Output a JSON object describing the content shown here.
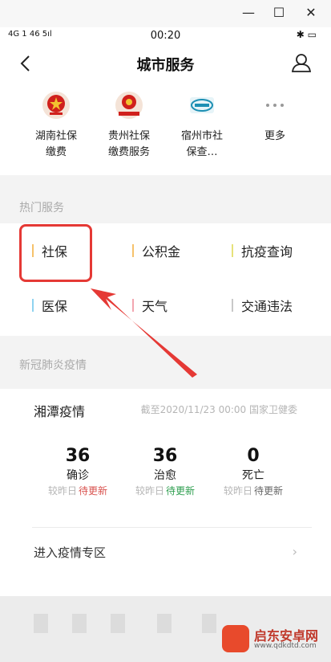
{
  "window": {
    "minimize_glyph": "—",
    "maximize_glyph": "☐",
    "close_glyph": "✕"
  },
  "status_bar": {
    "signal_text": "4G 1 46  5ıl",
    "time": "00:20",
    "right_icons": "✱ ▭"
  },
  "header": {
    "title": "城市服务",
    "back_icon": "chevron-left-icon",
    "user_icon": "user-icon"
  },
  "apps": [
    {
      "label_line1": "湖南社保",
      "label_line2": "缴费",
      "icon": "national-emblem-icon"
    },
    {
      "label_line1": "贵州社保",
      "label_line2": "缴费服务",
      "icon": "tax-emblem-icon"
    },
    {
      "label_line1": "宿州市社",
      "label_line2": "保查…",
      "icon": "social-security-card-icon"
    },
    {
      "label_line1": "更多",
      "label_line2": "",
      "icon": "more-dots-icon"
    }
  ],
  "hot_services": {
    "section_title": "热门服务",
    "items": [
      {
        "label": "社保",
        "bar_color": "#f6c26b"
      },
      {
        "label": "公积金",
        "bar_color": "#f6c26b"
      },
      {
        "label": "抗疫查询",
        "bar_color": "#e6e27a"
      },
      {
        "label": "医保",
        "bar_color": "#8fd3f0"
      },
      {
        "label": "天气",
        "bar_color": "#f3a6b0"
      },
      {
        "label": "交通违法",
        "bar_color": "#c8c8c8"
      }
    ]
  },
  "epidemic": {
    "section_title": "新冠肺炎疫情",
    "city": "湘潭疫情",
    "date_note": "截至2020/11/23 00:00 国家卫健委",
    "stats": [
      {
        "value": "36",
        "label": "确诊",
        "delta_prefix": "较昨日",
        "delta_status": "待更新",
        "status_color": "#d9534f"
      },
      {
        "value": "36",
        "label": "治愈",
        "delta_prefix": "较昨日",
        "delta_status": "待更新",
        "status_color": "#2e9e4f"
      },
      {
        "value": "0",
        "label": "死亡",
        "delta_prefix": "较昨日",
        "delta_status": "待更新",
        "status_color": "#666666"
      }
    ],
    "link_label": "进入疫情专区",
    "link_chevron": "›"
  },
  "watermark": {
    "name": "启东安卓网",
    "url": "www.qdkdtd.com"
  },
  "colors": {
    "highlight_red": "#e53935"
  }
}
